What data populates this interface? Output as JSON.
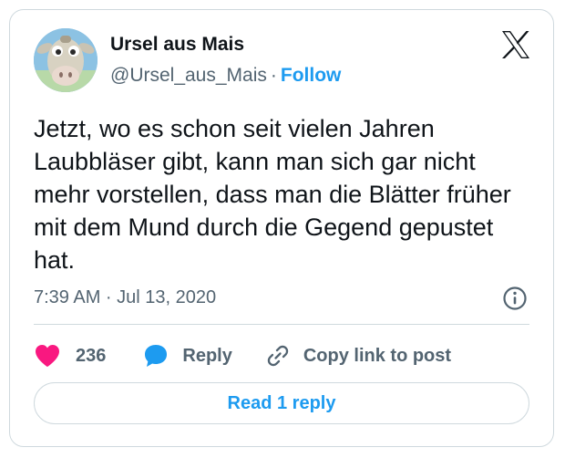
{
  "author": {
    "name": "Ursel aus Mais",
    "handle": "@Ursel_aus_Mais",
    "separator": "·",
    "follow_label": "Follow",
    "avatar_icon": "cartoon-animal-avatar"
  },
  "brand": {
    "logo_icon": "x-logo-icon"
  },
  "tweet": {
    "text": "Jetzt, wo es schon seit vielen Jahren Laubbläser gibt, kann man sich gar nicht mehr vorstellen, dass man die Blätter früher mit dem Mund durch die Gegend gepustet hat.",
    "timestamp": "7:39 AM · Jul 13, 2020"
  },
  "actions": {
    "like_count": "236",
    "reply_label": "Reply",
    "copy_label": "Copy link to post"
  },
  "footer": {
    "read_replies_label": "Read 1 reply"
  },
  "colors": {
    "accent": "#1d9bf0",
    "like": "#f91880",
    "text": "#0f1419",
    "muted": "#536471",
    "border": "#cfd9de"
  }
}
